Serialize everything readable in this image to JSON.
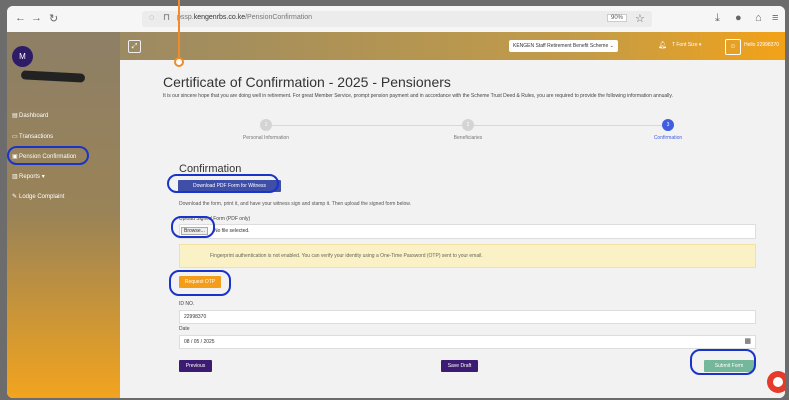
{
  "browser": {
    "url_prefix": "pssp.",
    "url_domain": "kengenrbs.co.ke",
    "url_path": "/PensionConfirmation",
    "zoom": "90%"
  },
  "sidebar": {
    "avatar_initial": "M",
    "items": [
      {
        "label": "Dashboard",
        "icon": "dashboard-icon"
      },
      {
        "label": "Transactions",
        "icon": "transactions-icon"
      },
      {
        "label": "Pension Confirmation",
        "icon": "confirmation-icon"
      },
      {
        "label": "Reports",
        "icon": "reports-icon"
      },
      {
        "label": "Lodge Complaint",
        "icon": "complaint-icon"
      }
    ]
  },
  "header": {
    "scheme_select": "KENGEN Staff Retirement Benefit Scheme",
    "font_size": "Font Size",
    "hello": "Hello 22998370"
  },
  "page": {
    "title": "Certificate of Confirmation - 2025 - Pensioners",
    "intro": "It is our sincere hope that you are doing well in retirement. For great Member Service, prompt pension payment and in accordance with the Scheme Trust Deed & Rules, you are required to provide the following information annually."
  },
  "steps": [
    {
      "number": "1",
      "label": "Personal Information"
    },
    {
      "number": "2",
      "label": "Beneficiaries"
    },
    {
      "number": "3",
      "label": "Confirmation"
    }
  ],
  "confirmation": {
    "title": "Confirmation",
    "download_label": "Download PDF Form for Witness",
    "instructions": "Download the form, print it, and have your witness sign and stamp it. Then upload the signed form below.",
    "upload_label": "Upload Signed Form (PDF only)",
    "browse_label": "Browse...",
    "no_file_text": "No file selected.",
    "alert": "Fingerprint authentication is not enabled. You can verify your identity using a One-Time Password (OTP) sent to your email.",
    "otp_label": "Request OTP",
    "id_label": "ID NO.",
    "id_value": "22998370",
    "date_label": "Date",
    "date_value": "08 / 05 / 2025",
    "previous_label": "Previous",
    "save_draft_label": "Save Draft",
    "submit_label": "Submit Form"
  },
  "colors": {
    "accent_purple": "#3c1c72",
    "sidebar_orange": "#f2a41e",
    "step_active": "#3f5ee0",
    "annotation_blue": "#1a34c8",
    "submit_green": "#74b79a"
  }
}
